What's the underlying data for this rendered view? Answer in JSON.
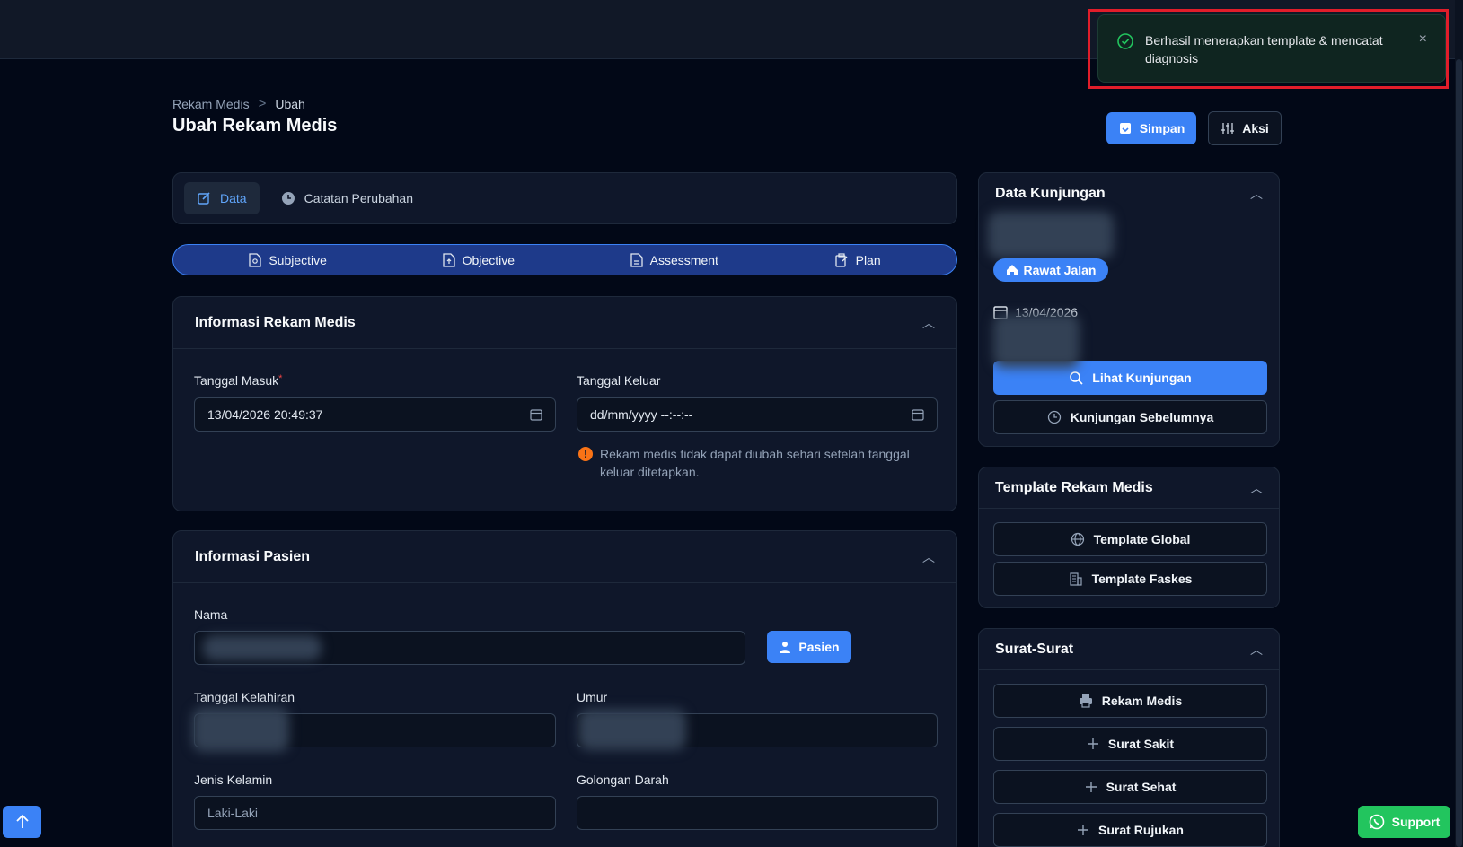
{
  "toast": {
    "message": "Berhasil menerapkan template & mencatat diagnosis",
    "close": "×"
  },
  "breadcrumb": {
    "root": "Rekam Medis",
    "separator": ">",
    "current": "Ubah"
  },
  "page_title": "Ubah Rekam Medis",
  "header_actions": {
    "save": "Simpan",
    "actions": "Aksi"
  },
  "tabs": [
    {
      "label": "Data",
      "active": true
    },
    {
      "label": "Catatan Perubahan",
      "active": false
    }
  ],
  "soap": [
    "Subjective",
    "Objective",
    "Assessment",
    "Plan"
  ],
  "rekam_medis": {
    "title": "Informasi Rekam Medis",
    "tanggal_masuk": {
      "label": "Tanggal Masuk",
      "required": "*",
      "value": "13/04/2026 20:49:37"
    },
    "tanggal_keluar": {
      "label": "Tanggal Keluar",
      "placeholder": "dd/mm/yyyy --:--:--"
    },
    "warning": "Rekam medis tidak dapat diubah sehari setelah tanggal keluar ditetapkan."
  },
  "pasien": {
    "title": "Informasi Pasien",
    "nama_label": "Nama",
    "pasien_button": "Pasien",
    "tanggal_lahir_label": "Tanggal Kelahiran",
    "umur_label": "Umur",
    "jenis_kelamin_label": "Jenis Kelamin",
    "jenis_kelamin_value": "Laki-Laki",
    "golongan_darah_label": "Golongan Darah"
  },
  "kunjungan": {
    "title": "Data Kunjungan",
    "badge": "Rawat Jalan",
    "date": "13/04/2026",
    "lihat": "Lihat Kunjungan",
    "sebelumnya": "Kunjungan Sebelumnya"
  },
  "template": {
    "title": "Template Rekam Medis",
    "global": "Template Global",
    "faskes": "Template Faskes"
  },
  "surat": {
    "title": "Surat-Surat",
    "items": [
      "Rekam Medis",
      "Surat Sakit",
      "Surat Sehat",
      "Surat Rujukan"
    ]
  },
  "support": "Support",
  "colors": {
    "accent": "#3b82f6",
    "success": "#22c55e",
    "warning": "#f97316",
    "background": "#020817"
  }
}
